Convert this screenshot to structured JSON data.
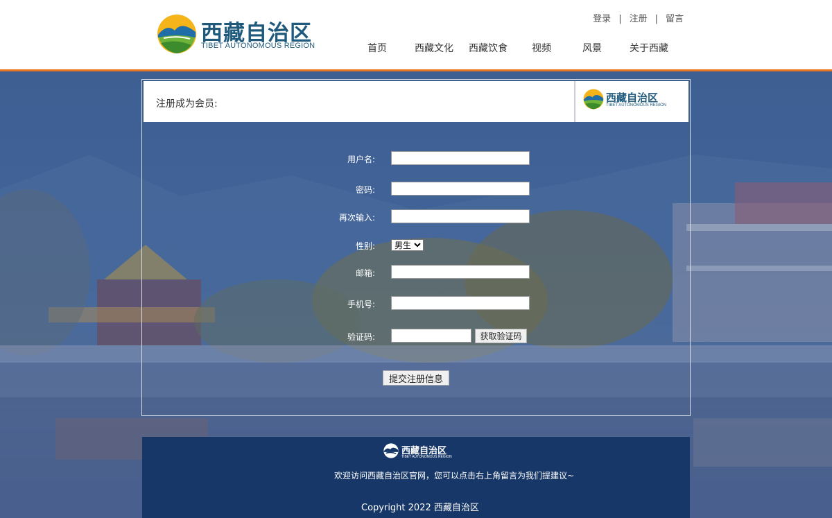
{
  "header": {
    "logo": {
      "cn": "西藏自治区",
      "en": "TIBET AUTONOMOUS REGION"
    },
    "top_links": [
      "登录",
      "注册",
      "留言"
    ],
    "nav": [
      "首页",
      "西藏文化",
      "西藏饮食",
      "视频",
      "风景",
      "关于西藏"
    ]
  },
  "form": {
    "title": "注册成为会员:",
    "logo": {
      "cn": "西藏自治区",
      "en": "TIBET AUTONOMOUS REGION"
    },
    "fields": {
      "username": {
        "label": "用户名:",
        "value": ""
      },
      "password": {
        "label": "密码:",
        "value": ""
      },
      "password_again": {
        "label": "再次输入:",
        "value": ""
      },
      "gender": {
        "label": "性别:",
        "selected": "男生"
      },
      "email": {
        "label": "邮箱:",
        "value": ""
      },
      "phone": {
        "label": "手机号:",
        "value": ""
      },
      "code": {
        "label": "验证码:",
        "value": ""
      }
    },
    "get_code_button": "获取验证码",
    "submit_button": "提交注册信息"
  },
  "footer": {
    "logo": {
      "cn": "西藏自治区",
      "en": "TIBET AUTONOMOUS REGION"
    },
    "message": "欢迎访问西藏自治区官网，您可以点击右上角留言为我们提建议~",
    "copyright": "Copyright 2022 西藏自治区"
  },
  "colors": {
    "accent_border": "#e9731f",
    "logo_text": "#1f5a7d",
    "footer_bg": "#163767",
    "background": "#2f4e7c"
  },
  "icons": {
    "logo_emblem": "mountain-sun-emblem-icon",
    "select_arrow": "chevron-down-icon"
  }
}
